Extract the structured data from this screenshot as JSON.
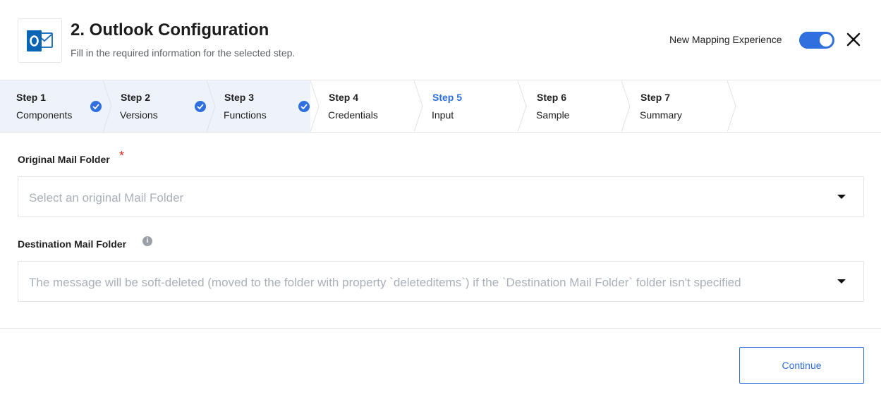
{
  "header": {
    "title": "2. Outlook Configuration",
    "subtitle": "Fill in the required information for the selected step.",
    "logo_icon": "outlook-logo",
    "toggle_label": "New Mapping Experience",
    "toggle_on": true,
    "close_icon": "close-icon"
  },
  "steps": [
    {
      "num": "Step 1",
      "label": "Components",
      "state": "done"
    },
    {
      "num": "Step 2",
      "label": "Versions",
      "state": "done"
    },
    {
      "num": "Step 3",
      "label": "Functions",
      "state": "done"
    },
    {
      "num": "Step 4",
      "label": "Credentials",
      "state": "pending"
    },
    {
      "num": "Step 5",
      "label": "Input",
      "state": "active"
    },
    {
      "num": "Step 6",
      "label": "Sample",
      "state": "pending"
    },
    {
      "num": "Step 7",
      "label": "Summary",
      "state": "pending"
    }
  ],
  "form": {
    "original": {
      "label": "Original Mail Folder",
      "required_mark": "*",
      "placeholder": "Select an original Mail Folder"
    },
    "destination": {
      "label": "Destination Mail Folder",
      "info_icon": "info-icon",
      "placeholder": "The message will be soft-deleted (moved to the folder with property `deleteditems`) if the `Destination Mail Folder` folder isn't specified"
    }
  },
  "footer": {
    "continue_label": "Continue"
  },
  "colors": {
    "accent": "#2f6fde",
    "completed_bg": "#eef3fb",
    "required": "#d93025"
  }
}
